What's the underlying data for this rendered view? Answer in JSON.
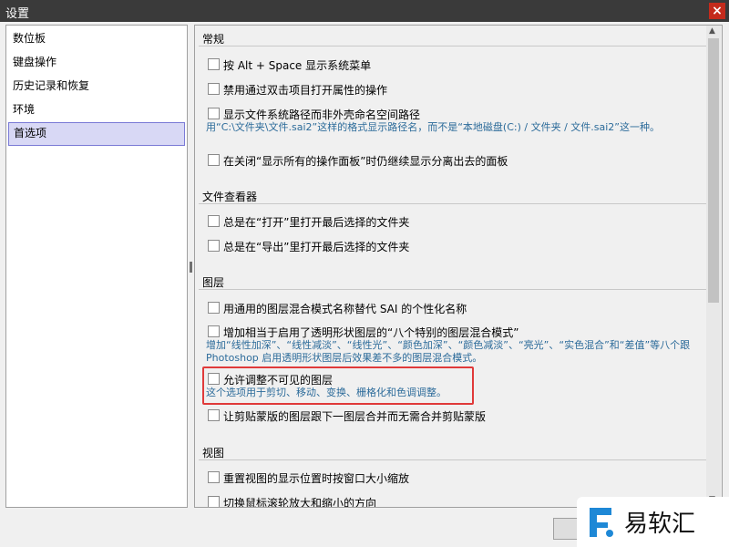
{
  "window": {
    "title": "设置",
    "close_glyph": "×"
  },
  "sidebar": {
    "items": [
      {
        "label": "数位板"
      },
      {
        "label": "键盘操作"
      },
      {
        "label": "历史记录和恢复"
      },
      {
        "label": "环境"
      },
      {
        "label": "首选项",
        "selected": true
      }
    ]
  },
  "sections": {
    "general": {
      "title": "常规",
      "options": [
        {
          "label": "按 Alt + Space 显示系统菜单",
          "checked": false
        },
        {
          "label": "禁用通过双击项目打开属性的操作",
          "checked": false
        },
        {
          "label": "显示文件系统路径而非外壳命名空间路径",
          "checked": false,
          "desc": "用“C:\\文件夹\\文件.sai2”这样的格式显示路径名，而不是“本地磁盘(C:) / 文件夹 / 文件.sai2”这一种。"
        },
        {
          "label": "在关闭“显示所有的操作面板”时仍继续显示分离出去的面板",
          "checked": false
        }
      ]
    },
    "viewer": {
      "title": "文件查看器",
      "options": [
        {
          "label": "总是在“打开”里打开最后选择的文件夹",
          "checked": false
        },
        {
          "label": "总是在“导出”里打开最后选择的文件夹",
          "checked": false
        }
      ]
    },
    "layers": {
      "title": "图层",
      "options": [
        {
          "label": "用通用的图层混合模式名称替代 SAI 的个性化名称",
          "checked": false
        },
        {
          "label": "增加相当于启用了透明形状图层的“八个特别的图层混合模式”",
          "checked": false,
          "desc": "增加“线性加深”、“线性减淡”、“线性光”、“颜色加深”、“颜色减淡”、“亮光”、“实色混合”和“差值”等八个跟 Photoshop 启用透明形状图层后效果差不多的图层混合模式。"
        },
        {
          "label": "允许调整不可见的图层",
          "checked": false,
          "desc": "这个选项用于剪切、移动、变换、栅格化和色调调整。"
        },
        {
          "label": "让剪贴蒙版的图层跟下一图层合并而无需合并剪贴蒙版",
          "checked": false
        }
      ]
    },
    "view": {
      "title": "视图",
      "options": [
        {
          "label": "重置视图的显示位置时按窗口大小缩放",
          "checked": false
        },
        {
          "label": "切换鼠标滚轮放大和缩小的方向",
          "checked": false
        }
      ]
    }
  },
  "scrollbar": {
    "up_glyph": "▲",
    "down_glyph": "▼"
  },
  "watermark": {
    "text": "易软汇"
  },
  "colors": {
    "highlight": "#e03a3a",
    "desc_text": "#2c6b9a",
    "selected_bg": "#d8d8f5"
  }
}
